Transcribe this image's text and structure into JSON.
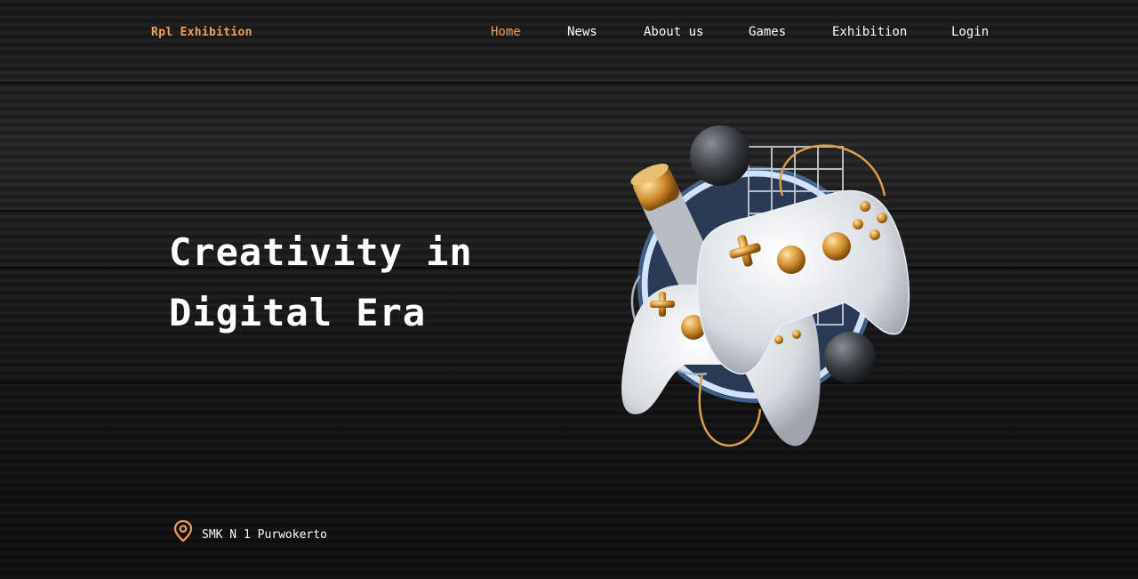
{
  "brand": {
    "logo_text": "Rpl Exhibition",
    "accent": "#f0a05a"
  },
  "nav": {
    "items": [
      {
        "label": "Home",
        "active": true
      },
      {
        "label": "News",
        "active": false
      },
      {
        "label": "About us",
        "active": false
      },
      {
        "label": "Games",
        "active": false
      },
      {
        "label": "Exhibition",
        "active": false
      },
      {
        "label": "Login",
        "active": false
      }
    ]
  },
  "hero": {
    "title_line1": "Creativity in",
    "title_line2": "Digital Era",
    "illustration": "game-controllers-illustration"
  },
  "location": {
    "icon": "map-pin-icon",
    "text": "SMK N 1 Purwokerto"
  }
}
